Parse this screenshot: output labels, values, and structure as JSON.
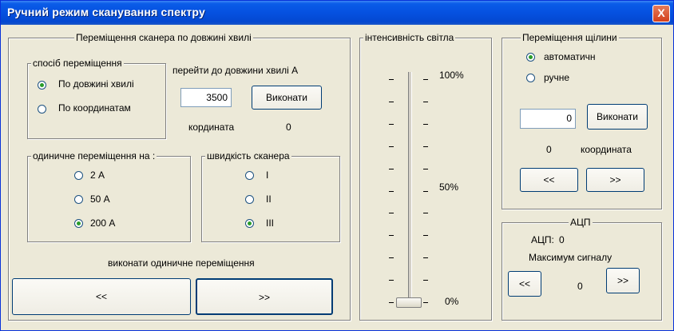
{
  "window": {
    "title": "Ручний режим сканування спектру",
    "close_label": "X"
  },
  "movement": {
    "title": "Переміщення сканера по довжині хвилі",
    "method": {
      "title": "спосіб переміщення",
      "options": [
        "По довжині хвилі",
        "По координатам"
      ],
      "selected": 0
    },
    "goto_label": "перейти до довжини хвилі А",
    "wavelength_value": "3500",
    "execute_label": "Виконати",
    "coord_label": "кордината",
    "coord_value": "0",
    "step": {
      "title": "одиничне переміщення на :",
      "options": [
        "2 А",
        "50 А",
        "200 А"
      ],
      "selected": 2
    },
    "speed": {
      "title": "швидкість сканера",
      "options": [
        "I",
        "II",
        "III"
      ],
      "selected": 2
    },
    "single_step_label": "виконати одиничне переміщення",
    "back_label": "<<",
    "forward_label": ">>"
  },
  "intensity": {
    "title": "інтенсивність світла",
    "labels": [
      "100%",
      "50%",
      "0%"
    ],
    "value": 0
  },
  "slit": {
    "title": "Переміщення щілини",
    "options": [
      "автоматичн",
      "ручне"
    ],
    "selected": 0,
    "input_value": "0",
    "execute_label": "Виконати",
    "coord_value": "0",
    "coord_label": "координата",
    "back_label": "<<",
    "forward_label": ">>"
  },
  "adc": {
    "title": "АЦП",
    "label": "АЦП:",
    "value": "0",
    "max_label": "Максимум сигналу",
    "max_value": "0",
    "back_label": "<<",
    "forward_label": ">>"
  }
}
